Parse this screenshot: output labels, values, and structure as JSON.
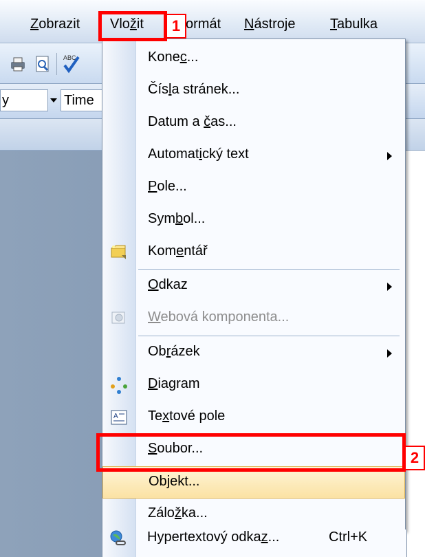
{
  "menubar": {
    "items": [
      {
        "id": "zobrazit",
        "pre": "",
        "u": "Z",
        "post": "obrazit"
      },
      {
        "id": "vlozit",
        "pre": "Vlo",
        "u": "ž",
        "post": "it"
      },
      {
        "id": "format",
        "text": "ormát"
      },
      {
        "id": "nastroje",
        "pre": "",
        "u": "N",
        "post": "ástroje"
      },
      {
        "id": "tabulka",
        "pre": "",
        "u": "T",
        "post": "abulka"
      }
    ],
    "left_fragment": "y",
    "font_fragment": "Time"
  },
  "menu": {
    "items": [
      {
        "pre": "Kone",
        "u": "c",
        "post": "...",
        "icon": "",
        "arrow": false,
        "disabled": false,
        "shortcut": ""
      },
      {
        "pre": "Čís",
        "u": "l",
        "post": "a stránek...",
        "icon": "",
        "arrow": false,
        "disabled": false,
        "shortcut": ""
      },
      {
        "pre": "Datum a ",
        "u": "č",
        "post": "as...",
        "icon": "",
        "arrow": false,
        "disabled": false,
        "shortcut": ""
      },
      {
        "pre": "Automat",
        "u": "i",
        "post": "cký text",
        "icon": "",
        "arrow": true,
        "disabled": false,
        "shortcut": ""
      },
      {
        "pre": "",
        "u": "P",
        "post": "ole...",
        "icon": "",
        "arrow": false,
        "disabled": false,
        "shortcut": ""
      },
      {
        "pre": "Sym",
        "u": "b",
        "post": "ol...",
        "icon": "",
        "arrow": false,
        "disabled": false,
        "shortcut": ""
      },
      {
        "pre": "Kom",
        "u": "e",
        "post": "ntář",
        "icon": "comment-icon",
        "arrow": false,
        "disabled": false,
        "shortcut": ""
      },
      {
        "pre": "",
        "u": "O",
        "post": "dkaz",
        "icon": "",
        "arrow": true,
        "disabled": false,
        "shortcut": ""
      },
      {
        "pre": "",
        "u": "W",
        "post": "ebová komponenta...",
        "icon": "web-component-icon",
        "arrow": false,
        "disabled": true,
        "shortcut": ""
      },
      {
        "pre": "Ob",
        "u": "r",
        "post": "ázek",
        "icon": "",
        "arrow": true,
        "disabled": false,
        "shortcut": ""
      },
      {
        "pre": "",
        "u": "D",
        "post": "iagram",
        "icon": "diagram-icon",
        "arrow": false,
        "disabled": false,
        "shortcut": ""
      },
      {
        "pre": "Te",
        "u": "x",
        "post": "tové pole",
        "icon": "text-box-icon",
        "arrow": false,
        "disabled": false,
        "shortcut": ""
      },
      {
        "pre": "",
        "u": "S",
        "post": "oubor...",
        "icon": "",
        "arrow": false,
        "disabled": false,
        "shortcut": ""
      },
      {
        "pre": "Ob",
        "u": "j",
        "post": "ekt...",
        "icon": "",
        "arrow": false,
        "disabled": false,
        "shortcut": "",
        "highlighted": true
      },
      {
        "pre": "Zálo",
        "u": "ž",
        "post": "ka...",
        "icon": "",
        "arrow": false,
        "disabled": false,
        "shortcut": ""
      },
      {
        "pre": "Hypertextový odka",
        "u": "z",
        "post": "...",
        "icon": "hyperlink-icon",
        "arrow": false,
        "disabled": false,
        "shortcut": "Ctrl+K"
      }
    ]
  },
  "annotations": {
    "step1": "1",
    "step2": "2"
  },
  "colors": {
    "annotation": "#ff0000",
    "highlight": "#fbe2a4",
    "menu_bg": "#f9fbff"
  }
}
